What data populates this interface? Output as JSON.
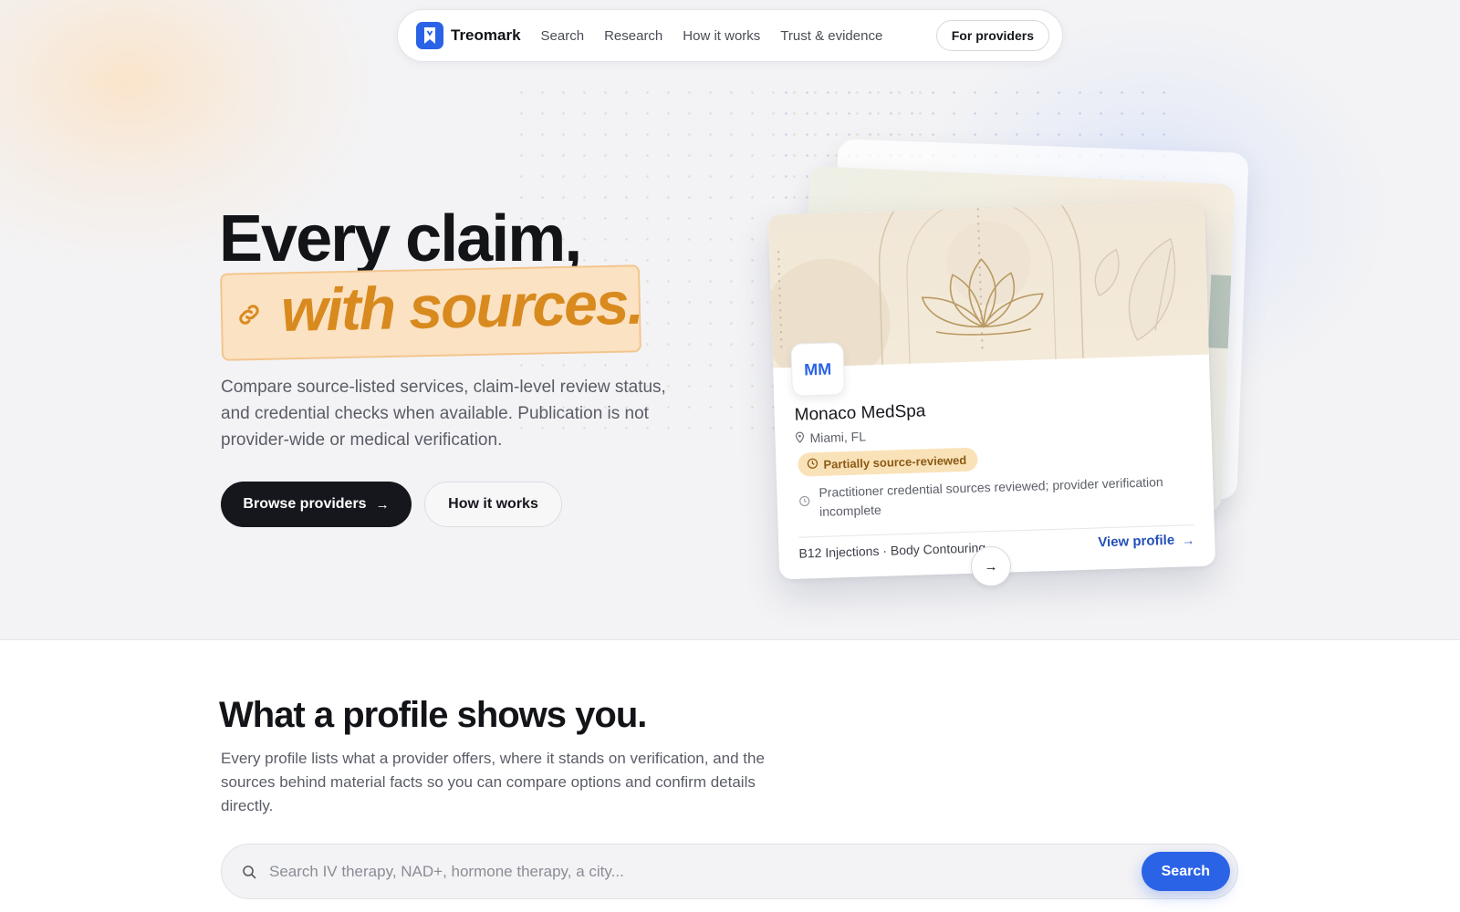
{
  "nav": {
    "brand": "Treomark",
    "links": [
      "Search",
      "Research",
      "How it works",
      "Trust & evidence"
    ],
    "cta": "For providers"
  },
  "hero": {
    "headline_line1": "Every claim,",
    "headline_line2": "with sources.",
    "subtitle": "Compare source-listed services, claim-level review status, and credential checks when available. Publication is not provider-wide or medical verification.",
    "primary_button": "Browse providers",
    "secondary_button": "How it works"
  },
  "provider_card": {
    "monogram": "MM",
    "name": "Monaco MedSpa",
    "location": "Miami, FL",
    "status_badge": "Partially source-reviewed",
    "note": "Practitioner credential sources reviewed; provider verification incomplete",
    "services": "B12 Injections · Body Contouring",
    "view_link": "View profile"
  },
  "section": {
    "title": "What a profile shows you.",
    "subtitle": "Every profile lists what a provider offers, where it stands on verification, and the sources behind material facts so you can compare options and confirm details directly."
  },
  "search": {
    "placeholder": "Search IV therapy, NAD+, hormone therapy, a city...",
    "button": "Search"
  },
  "colors": {
    "brand_blue": "#2b63e6",
    "accent_orange": "#d98a1f",
    "highlight_bg": "#fbe2c2",
    "badge_bg": "#fae2b8",
    "dark_button": "#15171c"
  },
  "icons": [
    "bookmark-logo-icon",
    "link-icon",
    "map-pin-icon",
    "clock-icon",
    "arrow-right-icon",
    "search-icon"
  ]
}
